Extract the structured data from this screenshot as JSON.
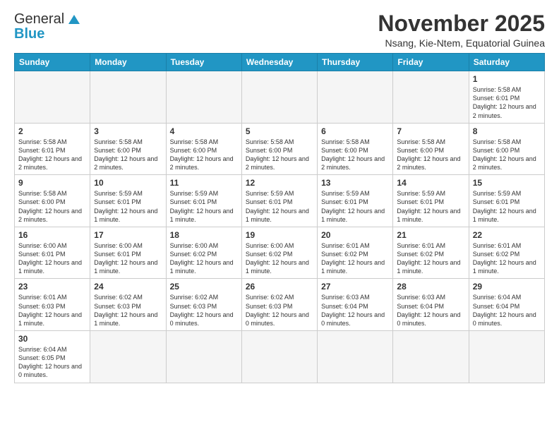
{
  "header": {
    "logo_general": "General",
    "logo_blue": "Blue",
    "month_title": "November 2025",
    "subtitle": "Nsang, Kie-Ntem, Equatorial Guinea"
  },
  "weekdays": [
    "Sunday",
    "Monday",
    "Tuesday",
    "Wednesday",
    "Thursday",
    "Friday",
    "Saturday"
  ],
  "weeks": [
    [
      {
        "day": "",
        "info": ""
      },
      {
        "day": "",
        "info": ""
      },
      {
        "day": "",
        "info": ""
      },
      {
        "day": "",
        "info": ""
      },
      {
        "day": "",
        "info": ""
      },
      {
        "day": "",
        "info": ""
      },
      {
        "day": "1",
        "info": "Sunrise: 5:58 AM\nSunset: 6:01 PM\nDaylight: 12 hours and 2 minutes."
      }
    ],
    [
      {
        "day": "2",
        "info": "Sunrise: 5:58 AM\nSunset: 6:01 PM\nDaylight: 12 hours and 2 minutes."
      },
      {
        "day": "3",
        "info": "Sunrise: 5:58 AM\nSunset: 6:00 PM\nDaylight: 12 hours and 2 minutes."
      },
      {
        "day": "4",
        "info": "Sunrise: 5:58 AM\nSunset: 6:00 PM\nDaylight: 12 hours and 2 minutes."
      },
      {
        "day": "5",
        "info": "Sunrise: 5:58 AM\nSunset: 6:00 PM\nDaylight: 12 hours and 2 minutes."
      },
      {
        "day": "6",
        "info": "Sunrise: 5:58 AM\nSunset: 6:00 PM\nDaylight: 12 hours and 2 minutes."
      },
      {
        "day": "7",
        "info": "Sunrise: 5:58 AM\nSunset: 6:00 PM\nDaylight: 12 hours and 2 minutes."
      },
      {
        "day": "8",
        "info": "Sunrise: 5:58 AM\nSunset: 6:00 PM\nDaylight: 12 hours and 2 minutes."
      }
    ],
    [
      {
        "day": "9",
        "info": "Sunrise: 5:58 AM\nSunset: 6:00 PM\nDaylight: 12 hours and 2 minutes."
      },
      {
        "day": "10",
        "info": "Sunrise: 5:59 AM\nSunset: 6:01 PM\nDaylight: 12 hours and 1 minute."
      },
      {
        "day": "11",
        "info": "Sunrise: 5:59 AM\nSunset: 6:01 PM\nDaylight: 12 hours and 1 minute."
      },
      {
        "day": "12",
        "info": "Sunrise: 5:59 AM\nSunset: 6:01 PM\nDaylight: 12 hours and 1 minute."
      },
      {
        "day": "13",
        "info": "Sunrise: 5:59 AM\nSunset: 6:01 PM\nDaylight: 12 hours and 1 minute."
      },
      {
        "day": "14",
        "info": "Sunrise: 5:59 AM\nSunset: 6:01 PM\nDaylight: 12 hours and 1 minute."
      },
      {
        "day": "15",
        "info": "Sunrise: 5:59 AM\nSunset: 6:01 PM\nDaylight: 12 hours and 1 minute."
      }
    ],
    [
      {
        "day": "16",
        "info": "Sunrise: 6:00 AM\nSunset: 6:01 PM\nDaylight: 12 hours and 1 minute."
      },
      {
        "day": "17",
        "info": "Sunrise: 6:00 AM\nSunset: 6:01 PM\nDaylight: 12 hours and 1 minute."
      },
      {
        "day": "18",
        "info": "Sunrise: 6:00 AM\nSunset: 6:02 PM\nDaylight: 12 hours and 1 minute."
      },
      {
        "day": "19",
        "info": "Sunrise: 6:00 AM\nSunset: 6:02 PM\nDaylight: 12 hours and 1 minute."
      },
      {
        "day": "20",
        "info": "Sunrise: 6:01 AM\nSunset: 6:02 PM\nDaylight: 12 hours and 1 minute."
      },
      {
        "day": "21",
        "info": "Sunrise: 6:01 AM\nSunset: 6:02 PM\nDaylight: 12 hours and 1 minute."
      },
      {
        "day": "22",
        "info": "Sunrise: 6:01 AM\nSunset: 6:02 PM\nDaylight: 12 hours and 1 minute."
      }
    ],
    [
      {
        "day": "23",
        "info": "Sunrise: 6:01 AM\nSunset: 6:03 PM\nDaylight: 12 hours and 1 minute."
      },
      {
        "day": "24",
        "info": "Sunrise: 6:02 AM\nSunset: 6:03 PM\nDaylight: 12 hours and 1 minute."
      },
      {
        "day": "25",
        "info": "Sunrise: 6:02 AM\nSunset: 6:03 PM\nDaylight: 12 hours and 0 minutes."
      },
      {
        "day": "26",
        "info": "Sunrise: 6:02 AM\nSunset: 6:03 PM\nDaylight: 12 hours and 0 minutes."
      },
      {
        "day": "27",
        "info": "Sunrise: 6:03 AM\nSunset: 6:04 PM\nDaylight: 12 hours and 0 minutes."
      },
      {
        "day": "28",
        "info": "Sunrise: 6:03 AM\nSunset: 6:04 PM\nDaylight: 12 hours and 0 minutes."
      },
      {
        "day": "29",
        "info": "Sunrise: 6:04 AM\nSunset: 6:04 PM\nDaylight: 12 hours and 0 minutes."
      }
    ],
    [
      {
        "day": "30",
        "info": "Sunrise: 6:04 AM\nSunset: 6:05 PM\nDaylight: 12 hours and 0 minutes."
      },
      {
        "day": "",
        "info": ""
      },
      {
        "day": "",
        "info": ""
      },
      {
        "day": "",
        "info": ""
      },
      {
        "day": "",
        "info": ""
      },
      {
        "day": "",
        "info": ""
      },
      {
        "day": "",
        "info": ""
      }
    ]
  ]
}
